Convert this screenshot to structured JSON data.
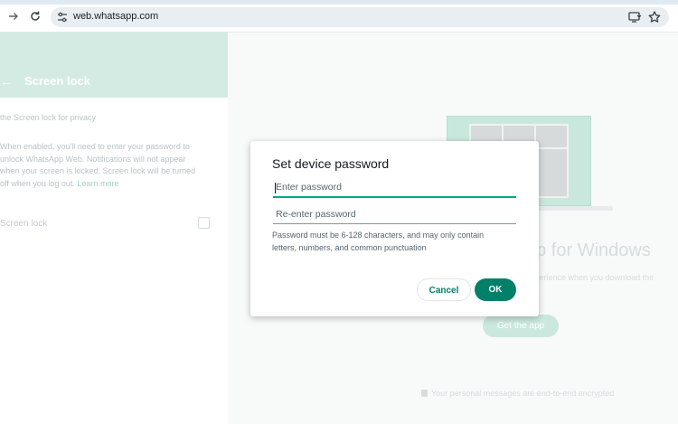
{
  "browser": {
    "url": "web.whatsapp.com",
    "icons": {
      "forward": "arrow-right-icon",
      "reload": "reload-icon",
      "site_info": "tune-icon",
      "install": "install-app-icon",
      "bookmark": "star-icon"
    }
  },
  "settings": {
    "header_title": "Screen lock",
    "subtitle": "the Screen lock for privacy",
    "description_lines": [
      "When enabled, you'll need to enter your password to",
      "unlock WhatsApp Web. Notifications will not appear",
      "when your screen is locked. Screen lock will be turned",
      "off when you log out."
    ],
    "learn_more": "Learn more",
    "toggle_label": "Screen lock",
    "toggle_checked": false
  },
  "promo": {
    "title": "pp for Windows",
    "subtitle": "experience when you download the",
    "get_app": "Get the app",
    "footer": "Your personal messages are end-to-end encrypted"
  },
  "dialog": {
    "title": "Set device password",
    "password_placeholder": "Enter password",
    "password_value": "",
    "confirm_placeholder": "Re-enter password",
    "confirm_value": "",
    "hint_line1": "Password must be 6-128 characters, and may only contain",
    "hint_line2": "letters, numbers, and common punctuation",
    "cancel_label": "Cancel",
    "ok_label": "OK"
  },
  "colors": {
    "accent": "#00a884",
    "primary_button": "#008069",
    "header_tint": "#d4ebe3"
  }
}
